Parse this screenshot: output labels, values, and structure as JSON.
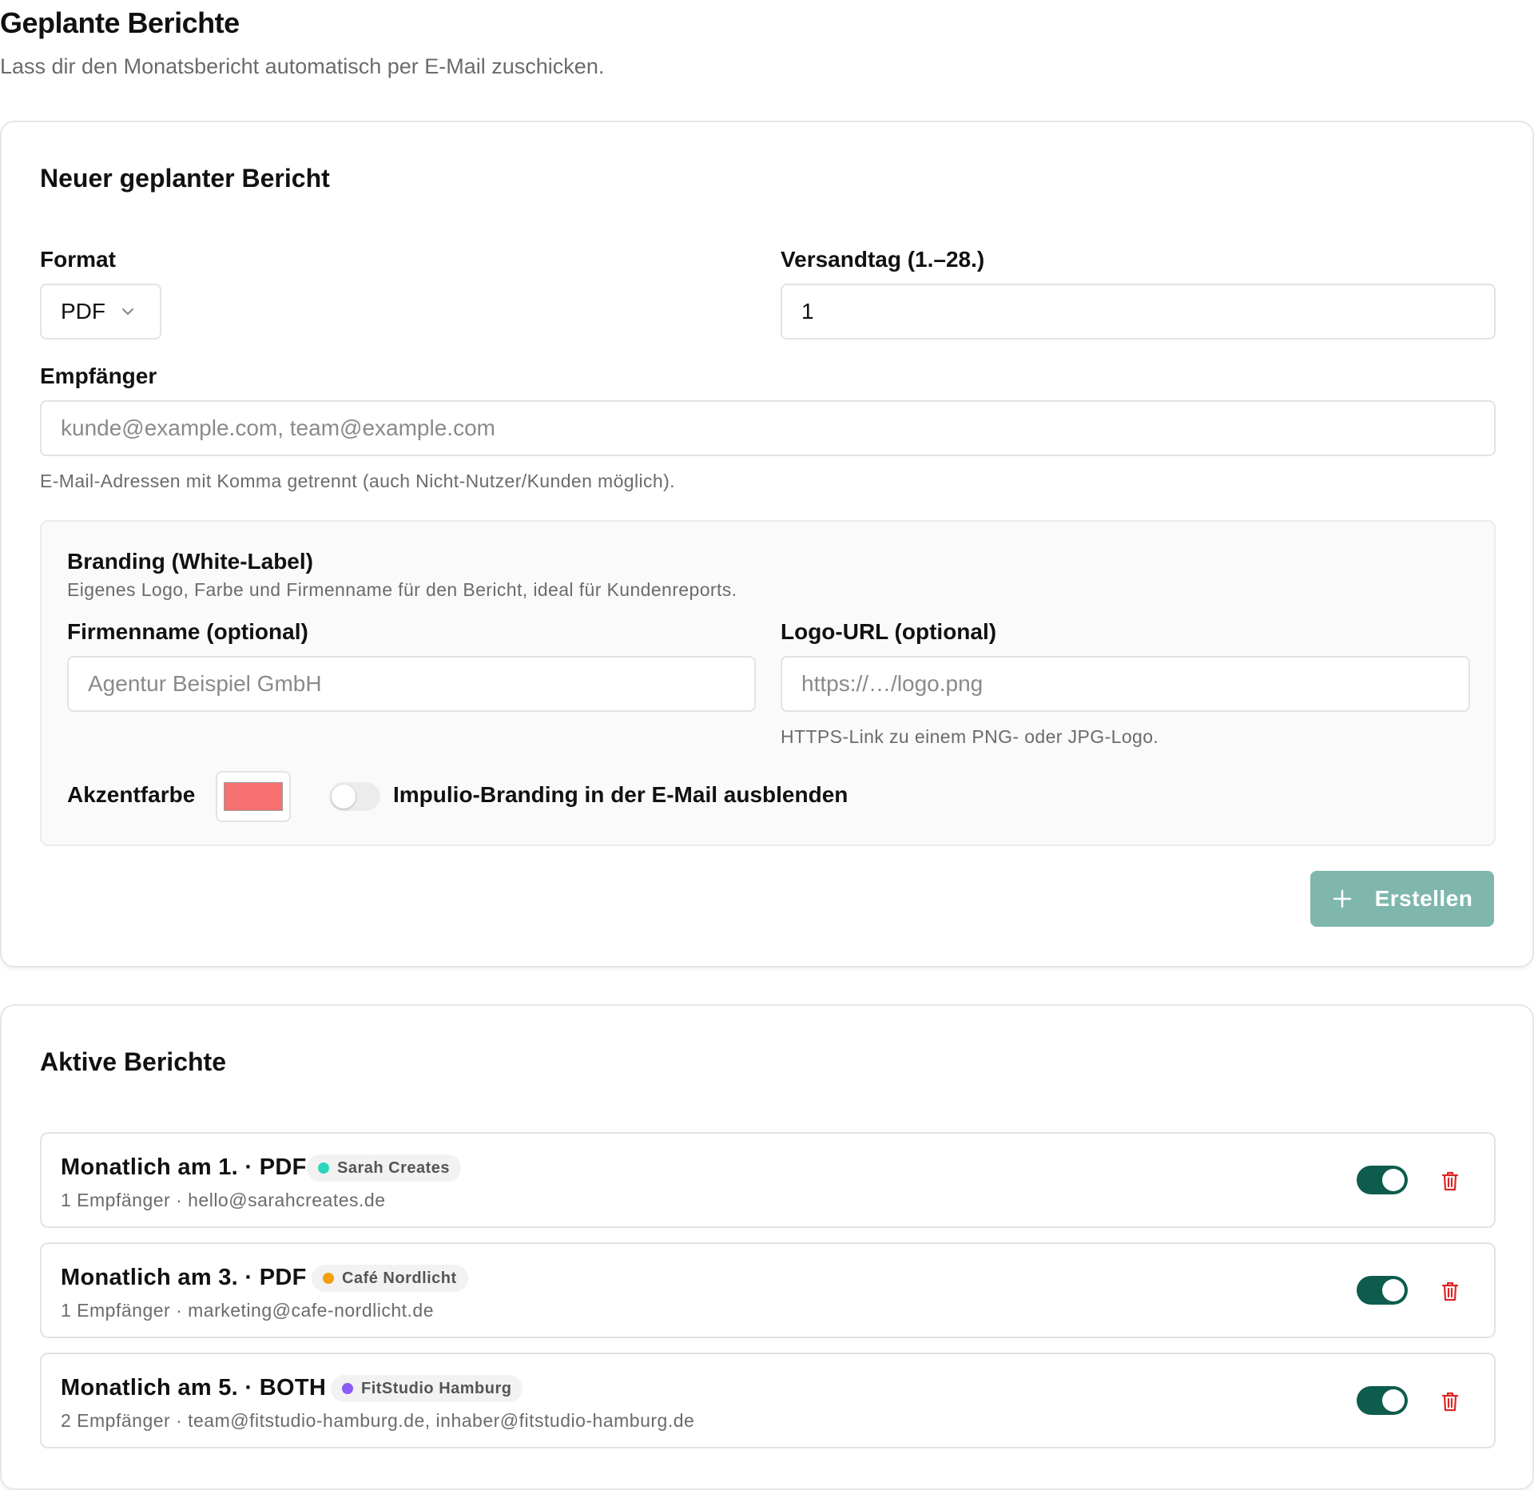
{
  "header": {
    "title": "Geplante Berichte",
    "subtitle": "Lass dir den Monatsbericht automatisch per E-Mail zuschicken."
  },
  "new_report": {
    "title": "Neuer geplanter Bericht",
    "format_label": "Format",
    "format_value": "PDF",
    "day_label": "Versandtag (1.–28.)",
    "day_value": "1",
    "recipients_label": "Empfänger",
    "recipients_placeholder": "kunde@example.com, team@example.com",
    "recipients_hint": "E-Mail-Adressen mit Komma getrennt (auch Nicht-Nutzer/Kunden möglich).",
    "branding": {
      "title": "Branding (White-Label)",
      "description": "Eigenes Logo, Farbe und Firmenname für den Bericht, ideal für Kundenreports.",
      "company_label": "Firmenname (optional)",
      "company_placeholder": "Agentur Beispiel GmbH",
      "logo_label": "Logo-URL (optional)",
      "logo_placeholder": "https://…/logo.png",
      "logo_hint": "HTTPS-Link zu einem PNG- oder JPG-Logo.",
      "accent_label": "Akzentfarbe",
      "accent_color": "#f87171",
      "hide_branding_label": "Impulio-Branding in der E-Mail ausblenden",
      "hide_branding_on": false
    },
    "create_label": "Erstellen"
  },
  "active_reports": {
    "title": "Aktive Berichte",
    "items": [
      {
        "title": "Monatlich am 1. · PDF",
        "client": "Sarah Creates",
        "client_color": "#2dd4bf",
        "details": "1 Empfänger · hello@sarahcreates.de",
        "enabled": true
      },
      {
        "title": "Monatlich am 3. · PDF",
        "client": "Café Nordlicht",
        "client_color": "#f59e0b",
        "details": "1 Empfänger · marketing@cafe-nordlicht.de",
        "enabled": true
      },
      {
        "title": "Monatlich am 5. · BOTH",
        "client": "FitStudio Hamburg",
        "client_color": "#8b5cf6",
        "details": "2 Empfänger · team@fitstudio-hamburg.de, inhaber@fitstudio-hamburg.de",
        "enabled": true
      }
    ]
  },
  "colors": {
    "primary": "#0d5c4d",
    "primary_disabled": "#7fb7ad",
    "danger": "#dc2626"
  }
}
